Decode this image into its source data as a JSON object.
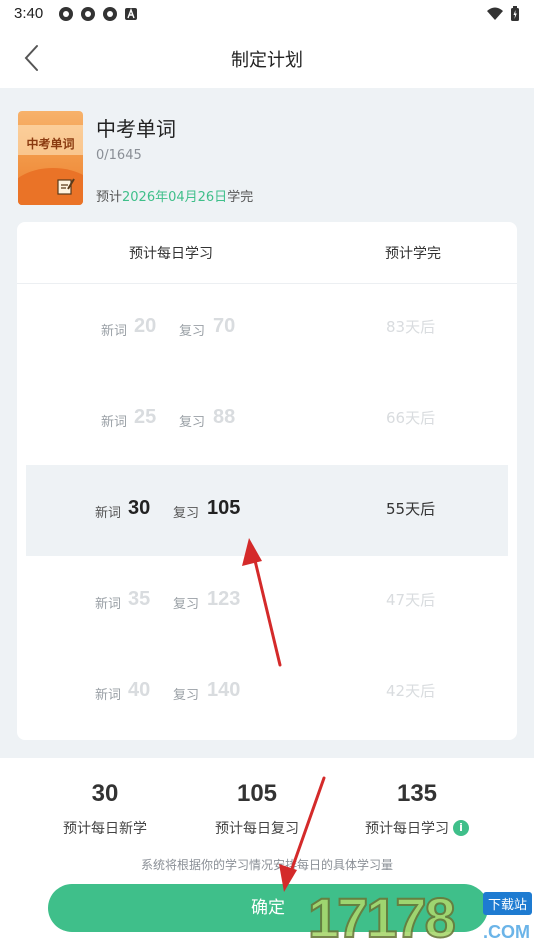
{
  "status_bar": {
    "time": "3:40",
    "left_icons": [
      "app-notification-icon",
      "app-notification-icon",
      "app-notification-icon",
      "text-a-icon"
    ],
    "right_icons": [
      "wifi-icon",
      "battery-icon"
    ]
  },
  "nav": {
    "title": "制定计划",
    "back_icon": "chevron-left-icon"
  },
  "book": {
    "cover_title": "中考单词",
    "name": "中考单词",
    "progress": "0/1645",
    "finish_prefix": "预计",
    "finish_date": "2026年04月26日",
    "finish_suffix": "学完"
  },
  "plan_table": {
    "col_daily": "预计每日学习",
    "col_finish": "预计学完",
    "new_label": "新词",
    "review_label": "复习",
    "options": [
      {
        "new": "20",
        "review": "70",
        "days": "83天后",
        "selected": false
      },
      {
        "new": "25",
        "review": "88",
        "days": "66天后",
        "selected": false
      },
      {
        "new": "30",
        "review": "105",
        "days": "55天后",
        "selected": true
      },
      {
        "new": "35",
        "review": "123",
        "days": "47天后",
        "selected": false
      },
      {
        "new": "40",
        "review": "140",
        "days": "42天后",
        "selected": false
      }
    ]
  },
  "summary": {
    "new_value": "30",
    "new_label": "预计每日新学",
    "review_value": "105",
    "review_label": "预计每日复习",
    "total_value": "135",
    "total_label": "预计每日学习",
    "note": "系统将根据你的学习情况安排每日的具体学习量"
  },
  "confirm_label": "确定",
  "watermark": {
    "digits": "17178",
    "tag": "下载站",
    "suffix": ".COM"
  },
  "colors": {
    "accent": "#3fbf8a",
    "annotation_arrow": "#d42a2a",
    "background": "#eef2f5"
  }
}
